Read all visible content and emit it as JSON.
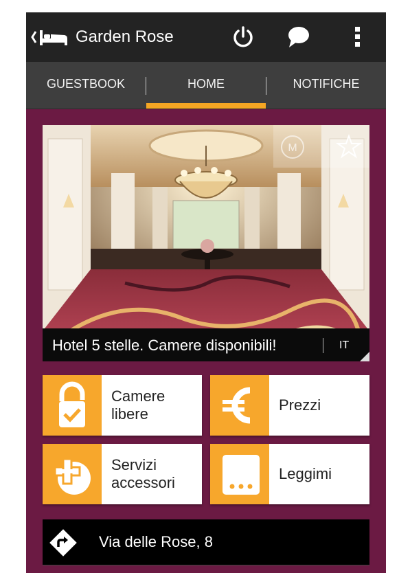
{
  "app": {
    "title": "Garden Rose"
  },
  "tabs": [
    {
      "label": "GUESTBOOK",
      "active": false
    },
    {
      "label": "HOME",
      "active": true
    },
    {
      "label": "NOTIFICHE",
      "active": false
    }
  ],
  "hero": {
    "caption": "Hotel 5 stelle. Camere disponibili!",
    "language": "IT",
    "badge_letter": "M"
  },
  "tiles": [
    {
      "label": "Camere libere",
      "icon": "lock-check-icon"
    },
    {
      "label": "Prezzi",
      "icon": "euro-icon"
    },
    {
      "label": "Servizi accessori",
      "icon": "plus-services-icon"
    },
    {
      "label": "Leggimi",
      "icon": "ellipsis-icon"
    }
  ],
  "address": {
    "text": "Via delle Rose, 8",
    "icon": "directions-icon"
  },
  "colors": {
    "accent": "#f7a72c",
    "background": "#6b1a43",
    "actionbar": "#232323",
    "tabbar": "#3e3e3e"
  }
}
